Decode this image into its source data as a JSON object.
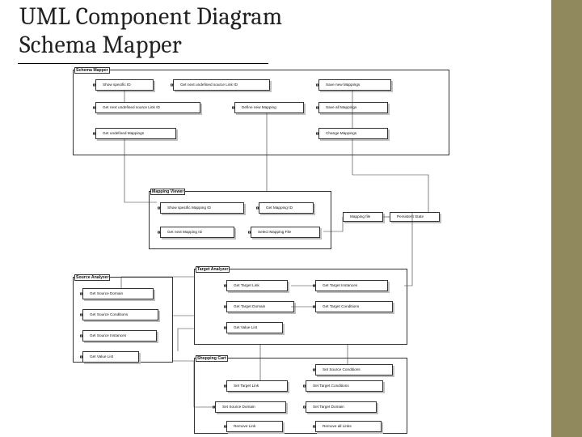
{
  "title_line1": "UML Component Diagram",
  "title_line2": "Schema Mapper",
  "frames": {
    "schema_mapper": {
      "label": "Schema Mapper"
    },
    "mapping_viewer": {
      "label": "Mapping Viewer"
    },
    "source_analyzer": {
      "label": "Source Analyzer"
    },
    "target_analyzer": {
      "label": "Target Analyzer"
    },
    "shopping_cart": {
      "label": "Shopping Cart"
    }
  },
  "comps": {
    "show_specific_id": "Show specific ID",
    "get_next_unused_source_link_id": "Get next undefined source Link ID",
    "get_next_undefined_source_link_id": "Get next undefined source Link ID",
    "get_undefined_mappings": "Get undefined Mappings",
    "define_new_mapping": "Define new Mapping",
    "save_new_mappings": "Save new Mappings",
    "save_all_mappings": "Save all Mappings",
    "change_mappings": "Change Mappings",
    "show_specific_mapping_id": "Show specific Mapping ID",
    "get_mapping_id": "Get Mapping ID",
    "get_next_mapping_id": "Get next Mapping ID",
    "select_mapping_file": "Select Mapping File",
    "mapping_file": "Mapping file",
    "persistent_state": "Persistent State",
    "get_source_domain": "Get Source Domain",
    "get_source_conditions": "Get Source Conditions",
    "get_source_instances": "Get Source Instances",
    "get_value_list": "Get Value List",
    "get_target_link": "Get Target Link",
    "get_target_domain": "Get Target Domain",
    "get_value_list2": "Get Value List",
    "get_target_instances": "Get Target Instances",
    "get_target_conditions": "Get Target Conditions",
    "set_target_link": "Set Target Link",
    "set_target_conditions": "Set Target Conditions",
    "set_source_domain": "Set Source Domain",
    "set_target_domain": "Set Target Domain",
    "remove_link": "Remove Link",
    "remove_all_links": "Remove all Links",
    "set_source_conditions": "Set Source Conditions"
  }
}
